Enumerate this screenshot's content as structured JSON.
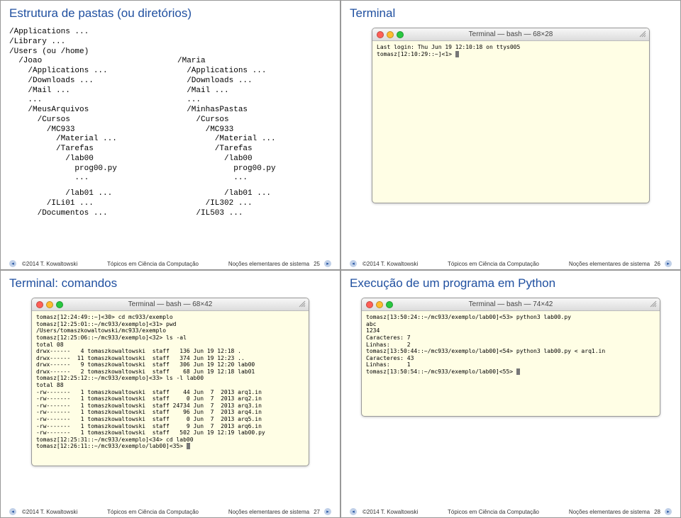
{
  "slide25": {
    "title": "Estrutura de pastas (ou diretórios)",
    "tree_left": "/Applications ...\n/Library ...\n/Users (ou /home)\n  /Joao\n    /Applications ...\n    /Downloads ...\n    /Mail ...\n    ...\n    /MeusArquivos\n      /Cursos\n        /MC933\n          /Material ...\n          /Tarefas\n            /lab00\n              prog00.py\n              ...",
    "tree_right": "\n\n\n/Maria\n  /Applications ...\n  /Downloads ...\n  /Mail ...\n  ...\n  /MinhasPastas\n    /Cursos\n      /MC933\n        /Material ...\n        /Tarefas\n          /lab00\n            prog00.py\n            ...",
    "tree_bottom_left": "            /lab01 ...\n        /ILi01 ...\n      /Documentos ...",
    "tree_bottom_right": "          /lab01 ...\n      /IL302 ...\n    /IL503 ...",
    "footer_copy": "©2014 T. Kowaltowski",
    "footer_mid": "Tópicos em Ciência da Computação",
    "footer_right": "Noções elementares de sistema",
    "slideno": "25"
  },
  "slide26": {
    "title": "Terminal",
    "term_title": "Terminal — bash — 68×28",
    "term_body": "Last login: Thu Jun 19 12:10:18 on ttys005\ntomasz[12:10:29::~]<1> ",
    "footer_copy": "©2014 T. Kowaltowski",
    "footer_mid": "Tópicos em Ciência da Computação",
    "footer_right": "Noções elementares de sistema",
    "slideno": "26"
  },
  "slide27": {
    "title": "Terminal: comandos",
    "term_title": "Terminal — bash — 68×42",
    "term_body": "tomasz[12:24:49::~]<30> cd mc933/exemplo\ntomasz[12:25:01::~/mc933/exemplo]<31> pwd\n/Users/tomaszkowaltowski/mc933/exemplo\ntomasz[12:25:06::~/mc933/exemplo]<32> ls -al\ntotal 08\ndrwx------   4 tomaszkowaltowski  staff   136 Jun 19 12:18 .\ndrwx------  11 tomaszkowaltowski  staff   374 Jun 19 12:23 ..\ndrwx------   9 tomaszkowaltowski  staff   306 Jun 19 12:20 lab00\ndrwx------   2 tomaszkowaltowski  staff    68 Jun 19 12:18 lab01\ntomasz[12:25:12::~/mc933/exemplo]<33> ls -l lab00\ntotal 88\n-rw-------   1 tomaszkowaltowski  staff    44 Jun  7  2013 arq1.in\n-rw-------   1 tomaszkowaltowski  staff     0 Jun  7  2013 arq2.in\n-rw-------   1 tomaszkowaltowski  staff 24734 Jun  7  2013 arq3.in\n-rw-------   1 tomaszkowaltowski  staff    96 Jun  7  2013 arq4.in\n-rw-------   1 tomaszkowaltowski  staff     0 Jun  7  2013 arq5.in\n-rw-------   1 tomaszkowaltowski  staff     9 Jun  7  2013 arq6.in\n-rw-------   1 tomaszkowaltowski  staff   502 Jun 19 12:19 lab00.py\ntomasz[12:25:31::~/mc933/exemplo]<34> cd lab00\ntomasz[12:26:11::~/mc933/exemplo/lab00]<35> ",
    "footer_copy": "©2014 T. Kowaltowski",
    "footer_mid": "Tópicos em Ciência da Computação",
    "footer_right": "Noções elementares de sistema",
    "slideno": "27"
  },
  "slide28": {
    "title": "Execução de um programa em Python",
    "term_title": "Terminal — bash — 74×42",
    "term_body": "tomasz[13:50:24::~/mc933/exemplo/lab00]<53> python3 lab00.py\nabc\n1234\nCaracteres: 7\nLinhas:     2\ntomasz[13:50:44::~/mc933/exemplo/lab00]<54> python3 lab00.py < arq1.in\nCaracteres: 43\nLinhas:     1\ntomasz[13:50:54::~/mc933/exemplo/lab00]<55> ",
    "footer_copy": "©2014 T. Kowaltowski",
    "footer_mid": "Tópicos em Ciência da Computação",
    "footer_right": "Noções elementares de sistema",
    "slideno": "28"
  }
}
